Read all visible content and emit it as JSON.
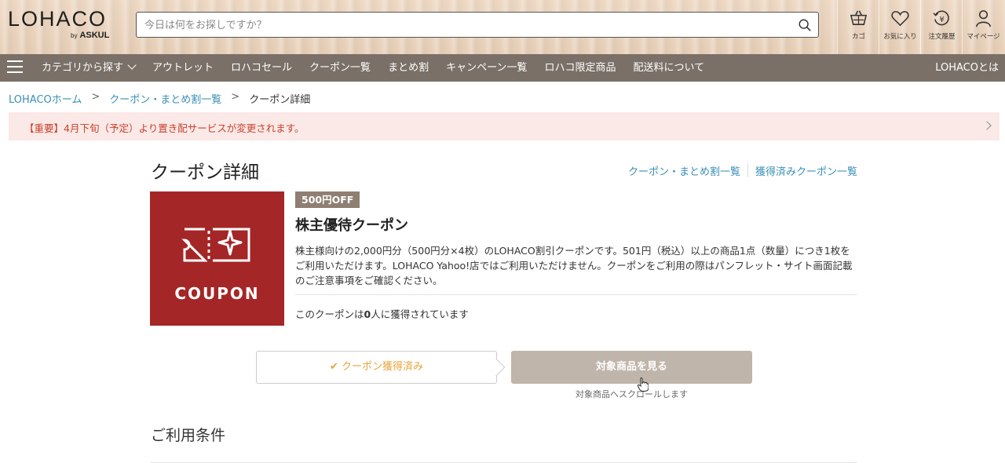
{
  "header": {
    "logo_main": "LOHACO",
    "logo_by": "by",
    "logo_brand": "ASKUL",
    "search_placeholder": "今日は何をお探しですか？",
    "icons": [
      {
        "name": "cart-icon",
        "label": "カゴ"
      },
      {
        "name": "heart-icon",
        "label": "お気に入り"
      },
      {
        "name": "order-history-icon",
        "label": "注文履歴"
      },
      {
        "name": "user-icon",
        "label": "マイページ"
      }
    ]
  },
  "nav": {
    "items": [
      "カテゴリから探す",
      "アウトレット",
      "ロハコセール",
      "クーポン一覧",
      "まとめ割",
      "キャンペーン一覧",
      "ロハコ限定商品",
      "配送料について"
    ],
    "about": "LOHACOとは"
  },
  "breadcrumb": {
    "home": "LOHACOホーム",
    "list": "クーポン・まとめ割一覧",
    "current": "クーポン詳細",
    "sep": ">"
  },
  "notice": {
    "text": "【重要】4月下旬（予定）より置き配サービスが変更されます。"
  },
  "main": {
    "title": "クーポン詳細",
    "link_list": "クーポン・まとめ割一覧",
    "link_acquired": "獲得済みクーポン一覧",
    "coupon_word": "COUPON",
    "badge": "500円OFF",
    "name": "株主優待クーポン",
    "description": "株主様向けの2,000円分（500円分×4枚）のLOHACO割引クーポンです。501円（税込）以上の商品1点（数量）につき1枚をご利用いただけます。LOHACO Yahoo!店ではご利用いただけません。クーポンをご利用の際はパンフレット・サイト画面記載のご注意事項をご確認ください。",
    "acquired_prefix": "このクーポンは",
    "acquired_count": "0",
    "acquired_suffix": "人に獲得されています",
    "btn_acquired": "クーポン獲得済み",
    "btn_view": "対象商品を見る",
    "scroll_note": "対象商品へスクロールします",
    "terms_title": "ご利用条件"
  },
  "colors": {
    "nav_bg": "#7a7068",
    "coupon_bg": "#a52626",
    "link": "#3a8fb7",
    "notice_text": "#c9402b",
    "acquired_text": "#e8a33a"
  }
}
